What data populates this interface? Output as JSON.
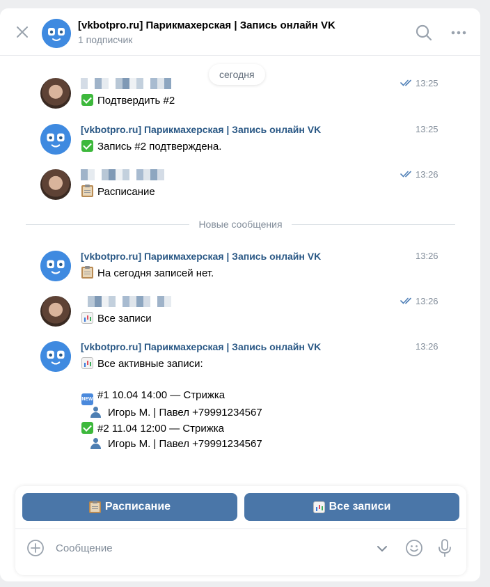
{
  "header": {
    "title": "[vkbotpro.ru] Парикмахерская | Запись онлайн VK",
    "subtitle": "1 подписчик"
  },
  "date_pill": "сегодня",
  "divider_label": "Новые сообщения",
  "messages": [
    {
      "sender": "user",
      "time": "13:25",
      "read": true,
      "lines": [
        {
          "emoji": "check",
          "text": "Подтвердить #2"
        }
      ]
    },
    {
      "sender": "bot",
      "sender_name": "[vkbotpro.ru] Парикмахерская | Запись онлайн VK",
      "time": "13:25",
      "lines": [
        {
          "emoji": "check",
          "text": "Запись #2 подтверждена."
        }
      ]
    },
    {
      "sender": "user",
      "time": "13:26",
      "read": true,
      "lines": [
        {
          "emoji": "clipboard",
          "text": "Расписание"
        }
      ]
    },
    {
      "sender": "bot",
      "sender_name": "[vkbotpro.ru] Парикмахерская | Запись онлайн VK",
      "time": "13:26",
      "lines": [
        {
          "emoji": "clipboard",
          "text": "На сегодня записей нет."
        }
      ]
    },
    {
      "sender": "user",
      "time": "13:26",
      "read": true,
      "lines": [
        {
          "emoji": "chart",
          "text": "Все записи"
        }
      ]
    },
    {
      "sender": "bot",
      "sender_name": "[vkbotpro.ru] Парикмахерская | Запись онлайн VK",
      "time": "13:26",
      "lines": [
        {
          "emoji": "chart",
          "text": "Все активные записи:"
        },
        {
          "emoji": "",
          "text": ""
        },
        {
          "emoji": "new",
          "text": "#1 10.04 14:00 — Стрижка"
        },
        {
          "emoji": "user",
          "text": "Игорь М. | Павел +79991234567",
          "indent": true
        },
        {
          "emoji": "check",
          "text": "#2 11.04 12:00 — Стрижка"
        },
        {
          "emoji": "user",
          "text": "Игорь М. | Павел +79991234567",
          "indent": true
        }
      ]
    }
  ],
  "keyboard": {
    "buttons": [
      {
        "emoji": "clipboard",
        "label": "Расписание"
      },
      {
        "emoji": "chart",
        "label": "Все записи"
      }
    ]
  },
  "composer": {
    "placeholder": "Сообщение"
  },
  "colors": {
    "accent": "#4a76a8",
    "link": "#2a5885",
    "secondary_text": "#818c99",
    "bot_avatar": "#3f8ae0"
  }
}
